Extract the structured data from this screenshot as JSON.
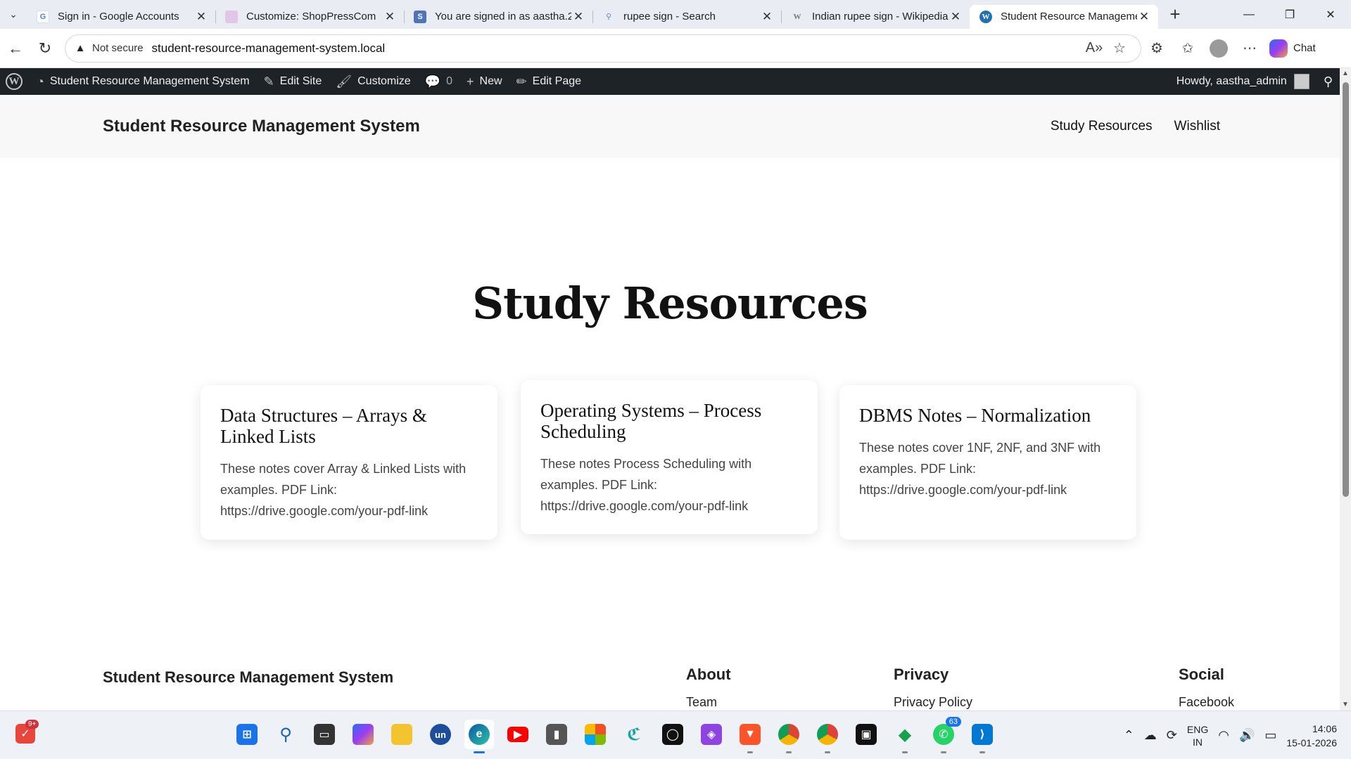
{
  "browser": {
    "tabs": [
      {
        "title": "Sign in - Google Accounts",
        "favicon": "google-icon",
        "color": "#4285f4",
        "active": false
      },
      {
        "title": "Customize: ShopPressCom",
        "favicon": "page-icon",
        "color": "#e3c5e8",
        "active": false
      },
      {
        "title": "You are signed in as aastha.2",
        "favicon": "s-icon",
        "color": "#4f74b8",
        "active": false
      },
      {
        "title": "rupee sign - Search",
        "favicon": "search-icon",
        "color": "#5b8bd9",
        "active": false
      },
      {
        "title": "Indian rupee sign - Wikipedia",
        "favicon": "wikipedia-icon",
        "color": "#888888",
        "active": false
      },
      {
        "title": "Student Resource Management",
        "favicon": "wordpress-icon",
        "color": "#2271b1",
        "active": true
      }
    ],
    "address": {
      "security_label": "Not secure",
      "url": "student-resource-management-system.local"
    },
    "chat_label": "Chat"
  },
  "adminbar": {
    "site_name": "Student Resource Management System",
    "edit_site": "Edit Site",
    "customize": "Customize",
    "comments_count": "0",
    "new_label": "New",
    "edit_page": "Edit Page",
    "howdy": "Howdy, aastha_admin"
  },
  "site": {
    "title": "Student Resource Management System",
    "nav": [
      "Study Resources",
      "Wishlist"
    ]
  },
  "main": {
    "heading": "Study Resources",
    "cards": [
      {
        "title": "Data Structures – Arrays & Linked Lists",
        "body": "These notes cover Array & Linked Lists with examples. PDF Link: https://drive.google.com/your-pdf-link"
      },
      {
        "title": "Operating Systems – Process Scheduling",
        "body": "These notes Process Scheduling with examples. PDF Link: https://drive.google.com/your-pdf-link"
      },
      {
        "title": "DBMS Notes – Normalization",
        "body": "These notes cover 1NF, 2NF, and 3NF with examples. PDF Link: https://drive.google.com/your-pdf-link"
      }
    ]
  },
  "footer": {
    "title": "Student Resource Management System",
    "columns": [
      {
        "heading": "About",
        "link": "Team"
      },
      {
        "heading": "Privacy",
        "link": "Privacy Policy"
      },
      {
        "heading": "Social",
        "link": "Facebook"
      }
    ]
  },
  "taskbar": {
    "notification_badge": "9+",
    "whatsapp_count": "63",
    "language": "ENG",
    "region": "IN",
    "time": "14:06",
    "date": "15-01-2026"
  }
}
